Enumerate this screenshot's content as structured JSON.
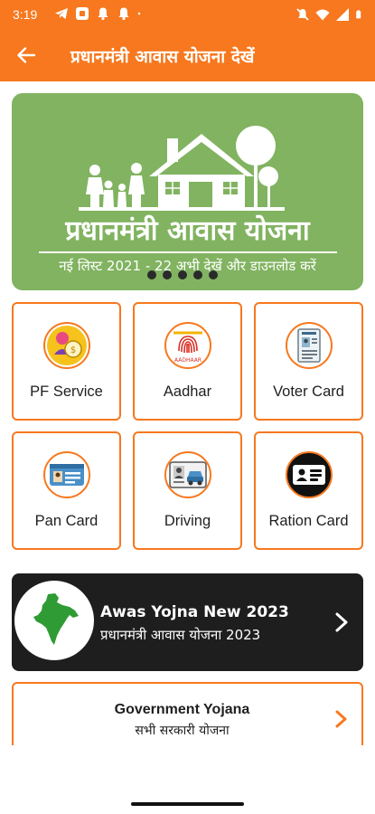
{
  "status_bar": {
    "time": "3:19",
    "left_icons": [
      "telegram-icon",
      "app-square-icon",
      "bell-icon",
      "bell-icon",
      "dot-icon"
    ],
    "right_icons": [
      "mute-icon",
      "wifi-icon",
      "signal-icon",
      "battery-icon"
    ]
  },
  "header": {
    "title": "प्रधानमंत्री आवास योजना देखें",
    "back_icon": "arrow-left-icon",
    "color": "#f7781e"
  },
  "banner": {
    "title": "प्रधानमंत्री आवास योजना",
    "subtitle": "नई लिस्ट 2021 - 22 अभी देखें और डाउनलोड करें",
    "bg_color": "#81b360",
    "slide_count": 5
  },
  "services": [
    {
      "label": "PF Service",
      "icon": "pf-service-icon"
    },
    {
      "label": "Aadhar",
      "icon": "aadhaar-fingerprint-icon"
    },
    {
      "label": "Voter Card",
      "icon": "voter-card-icon"
    },
    {
      "label": "Pan Card",
      "icon": "pan-card-icon"
    },
    {
      "label": "Driving",
      "icon": "driving-license-icon"
    },
    {
      "label": "Ration Card",
      "icon": "ration-card-icon"
    }
  ],
  "awas_card": {
    "title": "Awas Yojna New 2023",
    "subtitle": "प्रधानमंत्री आवास योजना 2023",
    "icon": "india-map-icon"
  },
  "gov_card": {
    "title": "Government Yojana",
    "subtitle": "सभी सरकारी योजना"
  },
  "colors": {
    "accent": "#f7781e",
    "dark_card": "#1e1e1e",
    "map_green": "#2e9b34"
  }
}
